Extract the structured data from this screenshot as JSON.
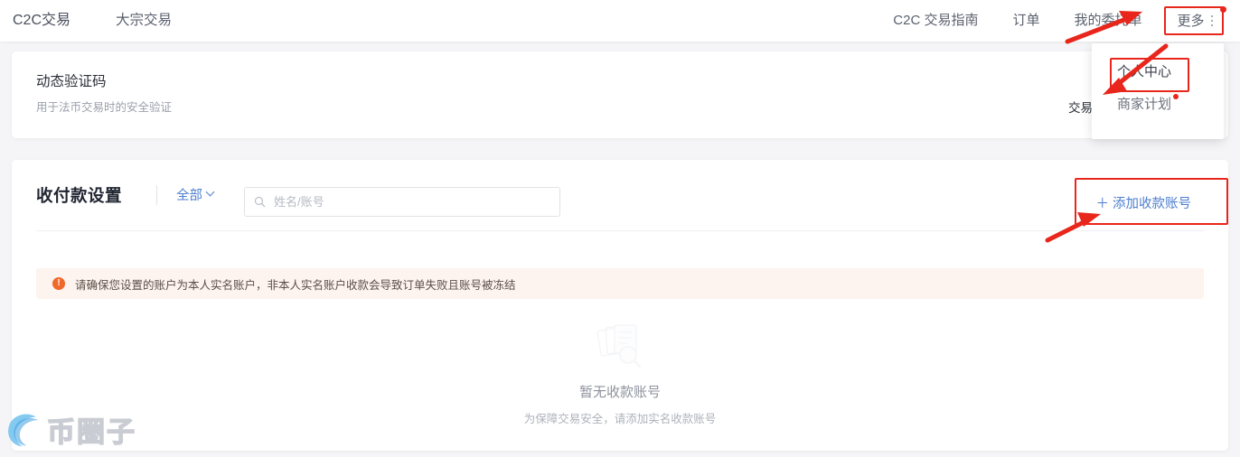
{
  "header": {
    "nav_left": [
      {
        "label": "C2C交易"
      },
      {
        "label": "大宗交易"
      }
    ],
    "nav_right": [
      {
        "label": "C2C 交易指南"
      },
      {
        "label": "订单"
      },
      {
        "label": "我的委托单"
      }
    ],
    "more": {
      "label": "更多",
      "icon": "kebab-vertical-icon",
      "has_badge": true
    }
  },
  "dropdown": {
    "items": [
      {
        "label": "个人中心",
        "highlighted": true,
        "badge": false
      },
      {
        "label": "商家计划",
        "highlighted": false,
        "badge": true
      }
    ]
  },
  "auth_card": {
    "title": "动态验证码",
    "subtitle": "用于法币交易时的安全验证",
    "action": "交易"
  },
  "payment_card": {
    "title": "收付款设置",
    "filter": {
      "label": "全部",
      "icon": "chevron-down-icon"
    },
    "search": {
      "placeholder": "姓名/账号",
      "value": "",
      "icon": "search-icon"
    },
    "add_button": {
      "label": "添加收款账号",
      "icon": "plus-icon"
    },
    "warning": {
      "icon": "warning-circle-icon",
      "text": "请确保您设置的账户为本人实名账户，非本人实名账户收款会导致订单失败且账号被冻结"
    },
    "empty_state": {
      "icon": "empty-documents-search-icon",
      "title": "暂无收款账号",
      "subtitle": "为保障交易安全，请添加实名收款账号"
    }
  },
  "annotations": {
    "accent_color": "#e8261c",
    "boxes": [
      {
        "target": "more-button"
      },
      {
        "target": "dropdown-item-personal-center"
      },
      {
        "target": "add-account-button"
      }
    ],
    "arrows": [
      {
        "target": "more-button"
      },
      {
        "target": "dropdown-item-personal-center"
      },
      {
        "target": "add-account-button"
      }
    ]
  },
  "watermark": {
    "text": "币圈子",
    "logo_icon": "swirl-c-logo-icon"
  },
  "theme": {
    "link_blue": "#4e7ecf",
    "warn_orange": "#f0682a",
    "warn_bg": "#fdf3ef",
    "page_bg": "#f5f5f7",
    "card_bg": "#ffffff"
  }
}
